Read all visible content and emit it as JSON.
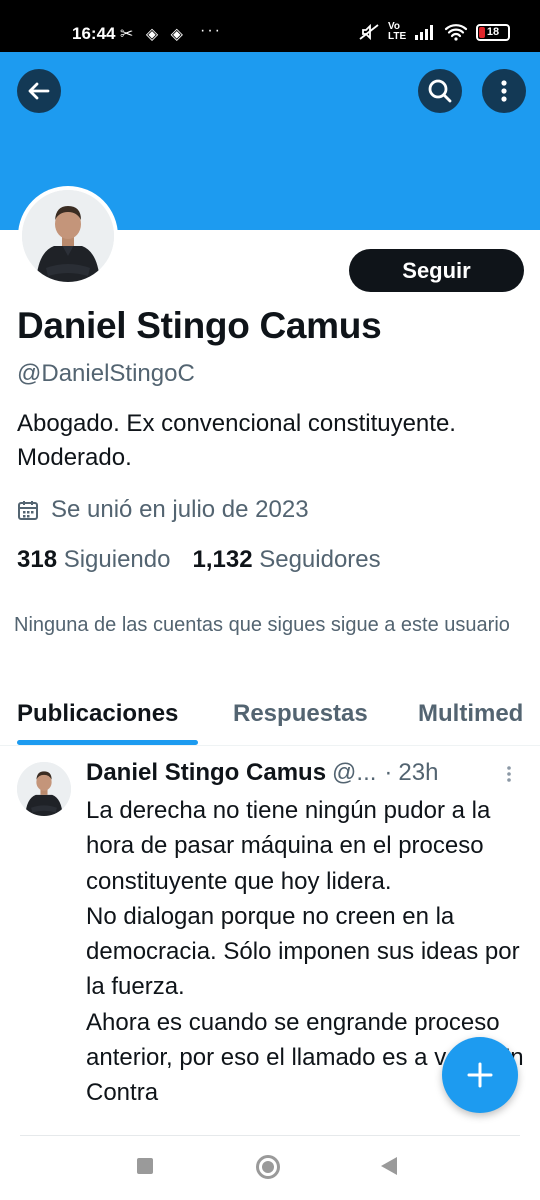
{
  "status_bar": {
    "time": "16:44",
    "notification_icons": "✂ ◈ ◈",
    "more": "···",
    "network": "Vo LTE",
    "battery": "18",
    "icons": [
      "mute-icon",
      "signal-icon",
      "wifi-icon",
      "battery-icon"
    ]
  },
  "header": {
    "back_icon": "arrow-left-icon",
    "search_icon": "search-icon",
    "more_icon": "more-vertical-icon",
    "banner_color": "#1d9bf0"
  },
  "profile": {
    "follow_label": "Seguir",
    "display_name": "Daniel Stingo Camus",
    "handle": "@DanielStingoC",
    "bio": "Abogado. Ex convencional constituyente. Moderado.",
    "joined": "Se unió en julio de 2023",
    "following_count": "318",
    "following_label": "Siguiendo",
    "followers_count": "1,132",
    "followers_label": "Seguidores",
    "followers_note": "Ninguna de las cuentas que sigues sigue a este usuario"
  },
  "tabs": [
    {
      "label": "Publicaciones",
      "active": true
    },
    {
      "label": "Respuestas",
      "active": false
    },
    {
      "label": "Multimed",
      "active": false
    }
  ],
  "tweet": {
    "name": "Daniel Stingo Camus",
    "handle": "@...",
    "separator": "·",
    "time": "23h",
    "text": "La derecha no tiene ningún pudor a la hora de pasar máquina en el proceso constituyente que hoy lidera.\nNo dialogan porque no creen en la democracia. Sólo imponen sus ideas por la fuerza.\nAhora es cuando se engrande proceso anterior, por eso el llamado es a votar En Contra"
  },
  "fab": {
    "icon": "plus-icon"
  },
  "colors": {
    "accent": "#1d9bf0",
    "text": "#0f1419",
    "secondary": "#536471"
  }
}
